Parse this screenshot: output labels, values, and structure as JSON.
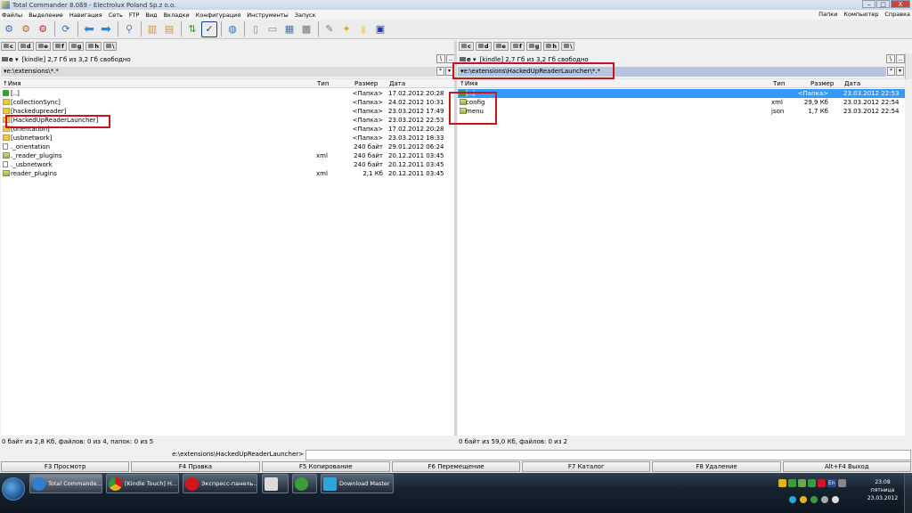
{
  "window": {
    "title": "Total Commander 8.0ß9 - Electrolux Poland Sp.z o.o.",
    "buttons": [
      "–",
      "□",
      "X"
    ]
  },
  "menu": {
    "left": [
      "Файлы",
      "Выделение",
      "Навигация",
      "Сеть",
      "FTP",
      "Вид",
      "Вкладки",
      "Конфигурация",
      "Инструменты",
      "Запуск"
    ],
    "right": [
      "Папки",
      "Компьютер",
      "Справка"
    ]
  },
  "toolbar": {
    "icons": [
      "gear-icon",
      "gear-icon",
      "gear-icon",
      "refresh-icon",
      "back-arrow-icon",
      "forward-arrow-icon",
      "network-icon",
      "pack-icon",
      "unpack-icon",
      "sort-icon",
      "checkmark-icon",
      "ftp-globe-icon",
      "new-file-icon",
      "copy-name-icon",
      "compare-icon",
      "grid-icon",
      "notepad-icon",
      "wand-icon",
      "note-icon",
      "panel-icon"
    ]
  },
  "left_panel": {
    "drives": [
      {
        "letter": "c"
      },
      {
        "letter": "d"
      },
      {
        "letter": "e"
      },
      {
        "letter": "f"
      },
      {
        "letter": "g"
      },
      {
        "letter": "h"
      },
      {
        "letter": "\\"
      }
    ],
    "drive_selector": "e",
    "volume_info": "[kindle]  2,7 Гб из 3,2 Гб свободно",
    "nav": [
      "\\",
      ".."
    ],
    "path": "e:\\extensions\\*.*",
    "path_buttons": [
      "*",
      "▾"
    ],
    "columns": {
      "name": "Имя",
      "type": "Тип",
      "size": "Размер",
      "date": "Дата"
    },
    "rows": [
      {
        "icon": "up",
        "name": "[..]",
        "type": "",
        "size": "<Папка>",
        "date": "17.02.2012 20:28"
      },
      {
        "icon": "folder",
        "name": "[collectionSync]",
        "type": "",
        "size": "<Папка>",
        "date": "24.02.2012 10:31"
      },
      {
        "icon": "folder",
        "name": "[hackedupreader]",
        "type": "",
        "size": "<Папка>",
        "date": "23.03.2012 17:49"
      },
      {
        "icon": "folder",
        "name": "[HackedUpReaderLauncher]",
        "type": "",
        "size": "<Папка>",
        "date": "23.03.2012 22:53"
      },
      {
        "icon": "folder",
        "name": "[orientation]",
        "type": "",
        "size": "<Папка>",
        "date": "17.02.2012 20:28"
      },
      {
        "icon": "folder",
        "name": "[usbnetwork]",
        "type": "",
        "size": "<Папка>",
        "date": "23.03.2012 18:33"
      },
      {
        "icon": "file",
        "name": "._orientation",
        "type": "",
        "size": "240 байт",
        "date": "29.01.2012 06:24"
      },
      {
        "icon": "xmlf",
        "name": "._reader_plugins",
        "type": "xml",
        "size": "240 байт",
        "date": "20.12.2011 03:45"
      },
      {
        "icon": "file",
        "name": "._usbnetwork",
        "type": "",
        "size": "240 байт",
        "date": "20.12.2011 03:45"
      },
      {
        "icon": "xmlf",
        "name": "reader_plugins",
        "type": "xml",
        "size": "2,1 Кб",
        "date": "20.12.2011 03:45"
      }
    ],
    "status": "0 байт из 2,8 Кб, файлов: 0 из 4, папок: 0 из 5"
  },
  "right_panel": {
    "drives": [
      {
        "letter": "c"
      },
      {
        "letter": "d"
      },
      {
        "letter": "e"
      },
      {
        "letter": "f"
      },
      {
        "letter": "g"
      },
      {
        "letter": "h"
      },
      {
        "letter": "\\"
      }
    ],
    "drive_selector": "e",
    "volume_info": "[kindle]  2,7 Гб из 3,2 Гб свободно",
    "nav": [
      "\\",
      ".."
    ],
    "path": "e:\\extensions\\HackedUpReaderLauncher\\*.*",
    "path_buttons": [
      "*",
      "▾"
    ],
    "columns": {
      "name": "Имя",
      "type": "Тип",
      "size": "Размер",
      "date": "Дата"
    },
    "rows": [
      {
        "icon": "up",
        "name": "[..]",
        "type": "",
        "size": "<Папка>",
        "date": "23.03.2012 22:53",
        "selected": true
      },
      {
        "icon": "xmlf",
        "name": "config",
        "type": "xml",
        "size": "29,9 Кб",
        "date": "23.03.2012 22:54"
      },
      {
        "icon": "xmlf",
        "name": "menu",
        "type": "json",
        "size": "1,7 Кб",
        "date": "23.03.2012 22:54"
      }
    ],
    "status": "0 байт из 59,0 Кб, файлов: 0 из 2"
  },
  "command_line": {
    "label": "e:\\extensions\\HackedUpReaderLauncher>",
    "value": ""
  },
  "fkeys": [
    "F3 Просмотр",
    "F4 Правка",
    "F5 Копирование",
    "F6 Перемещение",
    "F7 Каталог",
    "F8 Удаление",
    "Alt+F4 Выход"
  ],
  "taskbar": {
    "buttons": [
      {
        "label": "Total Commande...",
        "icon_color": "#2f7fd1",
        "active": true
      },
      {
        "label": "[Kindle Touch] H...",
        "icon_color": "#e8b21e",
        "active": false
      },
      {
        "label": "Экспресс-панель...",
        "icon_color": "#d5141b",
        "active": false
      },
      {
        "label": "",
        "icon_color": "#dcdcdc",
        "active": false
      },
      {
        "label": "",
        "icon_color": "#3a9d3a",
        "active": false
      },
      {
        "label": "Download Master",
        "icon_color": "#2aa6e0",
        "active": false
      }
    ],
    "tray_language": "En",
    "clock": {
      "time": "23:08",
      "day": "пятница",
      "date": "23.03.2012"
    }
  }
}
